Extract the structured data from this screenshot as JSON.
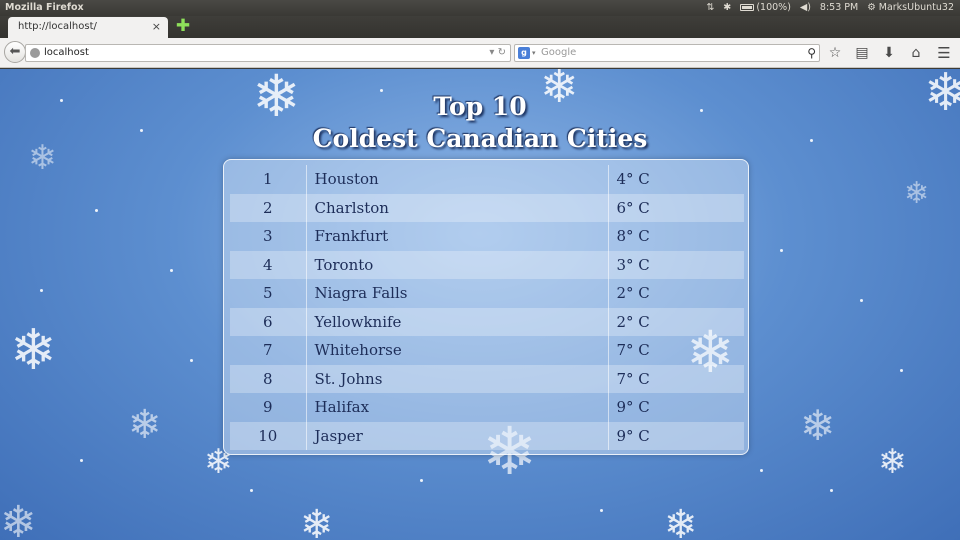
{
  "system_panel": {
    "app_title": "Mozilla Firefox",
    "battery": "(100%)",
    "time": "8:53 PM",
    "user": "MarksUbuntu32"
  },
  "browser": {
    "tab_title": "http://localhost/",
    "tab_close": "×",
    "new_tab": "✚",
    "url": "localhost",
    "search_placeholder": "Google",
    "search_engine": "g",
    "icons": [
      "back-icon",
      "globe-icon",
      "reload-icon",
      "search-icon",
      "bookmark-star-icon",
      "reader-icon",
      "download-icon",
      "home-icon",
      "menu-icon"
    ]
  },
  "page": {
    "title_line1": "Top 10",
    "title_line2": "Coldest Canadian Cities",
    "rows": [
      {
        "rank": "1",
        "city": "Houston",
        "temp": "4° C"
      },
      {
        "rank": "2",
        "city": "Charlston",
        "temp": "6° C"
      },
      {
        "rank": "3",
        "city": "Frankfurt",
        "temp": "8° C"
      },
      {
        "rank": "4",
        "city": "Toronto",
        "temp": "3° C"
      },
      {
        "rank": "5",
        "city": "Niagra Falls",
        "temp": "2° C"
      },
      {
        "rank": "6",
        "city": "Yellowknife",
        "temp": "2° C"
      },
      {
        "rank": "7",
        "city": "Whitehorse",
        "temp": "7° C"
      },
      {
        "rank": "8",
        "city": "St. Johns",
        "temp": "7° C"
      },
      {
        "rank": "9",
        "city": "Halifax",
        "temp": "9° C"
      },
      {
        "rank": "10",
        "city": "Jasper",
        "temp": "9° C"
      }
    ]
  },
  "colors": {
    "sky": "#5d8fd0",
    "text": "#1d2d58",
    "panel_chrome": "#3c3b37"
  }
}
